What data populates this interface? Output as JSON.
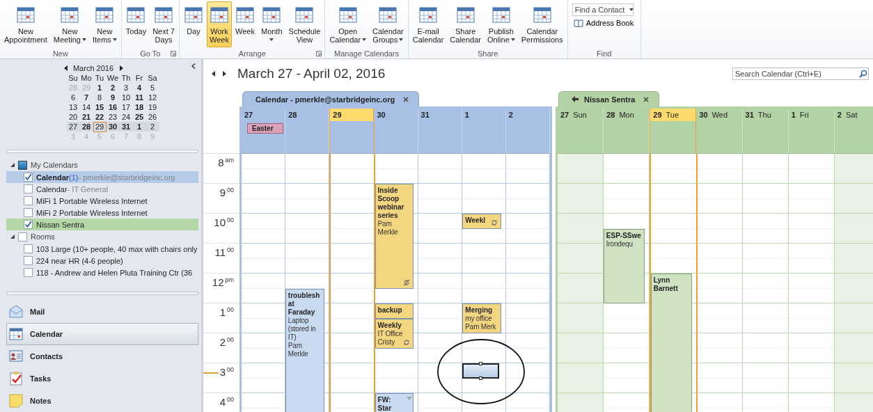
{
  "ribbon": {
    "groups": [
      {
        "kind": "buttons",
        "label": "New",
        "launcher": false,
        "buttons": [
          {
            "lines": [
              "New",
              "Appointment"
            ],
            "dropdown": false,
            "selected": false
          },
          {
            "lines": [
              "New",
              "Meeting"
            ],
            "dropdown": true,
            "selected": false
          },
          {
            "lines": [
              "New",
              "Items"
            ],
            "dropdown": true,
            "selected": false
          }
        ]
      },
      {
        "kind": "buttons",
        "label": "Go To",
        "launcher": true,
        "buttons": [
          {
            "lines": [
              "Today"
            ],
            "dropdown": false,
            "selected": false
          },
          {
            "lines": [
              "Next 7",
              "Days"
            ],
            "dropdown": false,
            "selected": false
          }
        ]
      },
      {
        "kind": "buttons",
        "label": "Arrange",
        "launcher": true,
        "buttons": [
          {
            "lines": [
              "Day"
            ],
            "dropdown": false,
            "selected": false
          },
          {
            "lines": [
              "Work",
              "Week"
            ],
            "dropdown": false,
            "selected": true
          },
          {
            "lines": [
              "Week"
            ],
            "dropdown": false,
            "selected": false
          },
          {
            "lines": [
              "Month"
            ],
            "dropdown": true,
            "selected": false
          },
          {
            "lines": [
              "Schedule",
              "View"
            ],
            "dropdown": false,
            "selected": false
          }
        ]
      },
      {
        "kind": "buttons",
        "label": "Manage Calendars",
        "launcher": false,
        "buttons": [
          {
            "lines": [
              "Open",
              "Calendar"
            ],
            "dropdown": true,
            "selected": false
          },
          {
            "lines": [
              "Calendar",
              "Groups"
            ],
            "dropdown": true,
            "selected": false
          }
        ]
      },
      {
        "kind": "buttons",
        "label": "Share",
        "launcher": false,
        "buttons": [
          {
            "lines": [
              "E-mail",
              "Calendar"
            ],
            "dropdown": false,
            "selected": false
          },
          {
            "lines": [
              "Share",
              "Calendar"
            ],
            "dropdown": false,
            "selected": false
          },
          {
            "lines": [
              "Publish",
              "Online"
            ],
            "dropdown": true,
            "selected": false
          },
          {
            "lines": [
              "Calendar",
              "Permissions"
            ],
            "dropdown": false,
            "selected": false
          }
        ]
      },
      {
        "kind": "find",
        "label": "Find",
        "launcher": false,
        "contact_field": {
          "placeholder": "Find a Contact"
        },
        "address_book": "Address Book"
      }
    ]
  },
  "sidebar": {
    "mini_calendar": {
      "month": "March 2016",
      "weekdays": [
        "Su",
        "Mo",
        "Tu",
        "We",
        "Th",
        "Fr",
        "Sa"
      ],
      "weeks": [
        {
          "selected": false,
          "days": [
            {
              "d": "28",
              "other": true,
              "bold": false,
              "today": false
            },
            {
              "d": "29",
              "other": true,
              "bold": false,
              "today": false
            },
            {
              "d": "1",
              "other": false,
              "bold": true,
              "today": false
            },
            {
              "d": "2",
              "other": false,
              "bold": true,
              "today": false
            },
            {
              "d": "3",
              "other": false,
              "bold": false,
              "today": false
            },
            {
              "d": "4",
              "other": false,
              "bold": true,
              "today": false
            },
            {
              "d": "5",
              "other": false,
              "bold": false,
              "today": false
            }
          ]
        },
        {
          "selected": false,
          "days": [
            {
              "d": "6",
              "other": false,
              "bold": false,
              "today": false
            },
            {
              "d": "7",
              "other": false,
              "bold": true,
              "today": false
            },
            {
              "d": "8",
              "other": false,
              "bold": false,
              "today": false
            },
            {
              "d": "9",
              "other": false,
              "bold": true,
              "today": false
            },
            {
              "d": "10",
              "other": false,
              "bold": false,
              "today": false
            },
            {
              "d": "11",
              "other": false,
              "bold": true,
              "today": false
            },
            {
              "d": "12",
              "other": false,
              "bold": false,
              "today": false
            }
          ]
        },
        {
          "selected": false,
          "days": [
            {
              "d": "13",
              "other": false,
              "bold": false,
              "today": false
            },
            {
              "d": "14",
              "other": false,
              "bold": false,
              "today": false
            },
            {
              "d": "15",
              "other": false,
              "bold": true,
              "today": false
            },
            {
              "d": "16",
              "other": false,
              "bold": true,
              "today": false
            },
            {
              "d": "17",
              "other": false,
              "bold": false,
              "today": false
            },
            {
              "d": "18",
              "other": false,
              "bold": true,
              "today": false
            },
            {
              "d": "19",
              "other": false,
              "bold": false,
              "today": false
            }
          ]
        },
        {
          "selected": false,
          "days": [
            {
              "d": "20",
              "other": false,
              "bold": false,
              "today": false
            },
            {
              "d": "21",
              "other": false,
              "bold": true,
              "today": false
            },
            {
              "d": "22",
              "other": false,
              "bold": true,
              "today": false
            },
            {
              "d": "23",
              "other": false,
              "bold": false,
              "today": false
            },
            {
              "d": "24",
              "other": false,
              "bold": false,
              "today": false
            },
            {
              "d": "25",
              "other": false,
              "bold": true,
              "today": false
            },
            {
              "d": "26",
              "other": false,
              "bold": false,
              "today": false
            }
          ]
        },
        {
          "selected": true,
          "days": [
            {
              "d": "27",
              "other": false,
              "bold": false,
              "today": false
            },
            {
              "d": "28",
              "other": false,
              "bold": true,
              "today": false
            },
            {
              "d": "29",
              "other": false,
              "bold": false,
              "today": true
            },
            {
              "d": "30",
              "other": false,
              "bold": true,
              "today": false
            },
            {
              "d": "31",
              "other": false,
              "bold": true,
              "today": false
            },
            {
              "d": "1",
              "other": false,
              "bold": true,
              "today": false
            },
            {
              "d": "2",
              "other": false,
              "bold": false,
              "today": false
            }
          ]
        },
        {
          "selected": false,
          "days": [
            {
              "d": "3",
              "other": true,
              "bold": false,
              "today": false
            },
            {
              "d": "4",
              "other": true,
              "bold": false,
              "today": false
            },
            {
              "d": "5",
              "other": true,
              "bold": false,
              "today": false
            },
            {
              "d": "6",
              "other": true,
              "bold": false,
              "today": false
            },
            {
              "d": "7",
              "other": true,
              "bold": false,
              "today": false
            },
            {
              "d": "8",
              "other": true,
              "bold": false,
              "today": false
            },
            {
              "d": "9",
              "other": true,
              "bold": false,
              "today": false
            }
          ]
        }
      ]
    },
    "folders": [
      {
        "label": "My Calendars",
        "expanded": true,
        "checked": true,
        "items": [
          {
            "name": "Calendar",
            "count": "(1)",
            "detail": "- pmerkle@starbridgeinc.org",
            "checked": true,
            "color": "#b6cbe8"
          },
          {
            "name": "Calendar",
            "detail": "- IT General",
            "checked": false
          },
          {
            "name": "MiFi 1 Portable Wireless Internet",
            "checked": false
          },
          {
            "name": "MiFi 2 Portable Wireless Internet",
            "checked": false
          },
          {
            "name": "Nissan Sentra",
            "checked": true,
            "color": "#b5d6a7"
          }
        ]
      },
      {
        "label": "Rooms",
        "expanded": true,
        "checked": false,
        "items": [
          {
            "name": "103 Large (10+ people, 40 max with chairs only",
            "checked": false
          },
          {
            "name": "224 near HR (4-6 people)",
            "checked": false
          },
          {
            "name": "118 - Andrew and Helen Pluta Training Ctr (36",
            "checked": false
          }
        ]
      }
    ],
    "nav": [
      {
        "label": "Mail",
        "selected": false
      },
      {
        "label": "Calendar",
        "selected": true
      },
      {
        "label": "Contacts",
        "selected": false
      },
      {
        "label": "Tasks",
        "selected": false
      },
      {
        "label": "Notes",
        "selected": false
      }
    ]
  },
  "main": {
    "title": "March 27 - April 02, 2016",
    "search": {
      "placeholder": "Search Calendar (Ctrl+E)"
    },
    "time_labels": [
      {
        "hour": "8",
        "suffix": "am"
      },
      {
        "hour": "9",
        "suffix": "00"
      },
      {
        "hour": "10",
        "suffix": "00"
      },
      {
        "hour": "11",
        "suffix": "00"
      },
      {
        "hour": "12",
        "suffix": "pm"
      },
      {
        "hour": "1",
        "suffix": "00"
      },
      {
        "hour": "2",
        "suffix": "00"
      },
      {
        "hour": "3",
        "suffix": "00"
      },
      {
        "hour": "4",
        "suffix": "00"
      }
    ],
    "panes": [
      {
        "title": "Calendar - pmerkle@starbridgeinc.org",
        "overlay_arrow": false,
        "color": "#a7c0e3",
        "days": [
          {
            "number": "27",
            "today": false,
            "shaded": false,
            "all_day": [
              {
                "title": "Easter",
                "color": "#dba3ba"
              }
            ]
          },
          {
            "number": "28",
            "today": false,
            "shaded": false,
            "events": [
              {
                "kind": "appointment",
                "title": "troublesh at Faraday",
                "detail": [
                  "Laptop (stored in IT)",
                  "Pam Merkle"
                ],
                "color": "#c9dbf0"
              }
            ]
          },
          {
            "number": "29",
            "today": true,
            "shaded": false
          },
          {
            "number": "30",
            "today": false,
            "shaded": false,
            "events": [
              {
                "kind": "exception",
                "title": "Inside Scoop webinar series",
                "detail": [
                  "Pam Merkle"
                ],
                "color": "#f5d680"
              },
              {
                "kind": "appointment",
                "title": "backup",
                "color": "#f5d680"
              },
              {
                "kind": "recurring",
                "title": "Weekly",
                "detail": [
                  "IT Office",
                  "Cristy"
                ],
                "color": "#f5d680"
              },
              {
                "kind": "overflow",
                "title": "FW: Star",
                "color": "#c9dbf0"
              }
            ]
          },
          {
            "number": "31",
            "today": false,
            "shaded": false
          },
          {
            "number": "1",
            "today": false,
            "shaded": false,
            "events": [
              {
                "kind": "recurring",
                "title": "Weekl",
                "color": "#f5d680"
              },
              {
                "kind": "appointment",
                "title": "Merging",
                "detail": [
                  "my office",
                  "Pam Merk"
                ],
                "color": "#f5d680"
              },
              {
                "kind": "selection",
                "circled": true
              }
            ]
          },
          {
            "number": "2",
            "today": false,
            "shaded": false
          }
        ]
      },
      {
        "title": "Nissan Sentra",
        "overlay_arrow": true,
        "color": "#b3d2a5",
        "days": [
          {
            "number": "27",
            "name": "Sun",
            "today": false,
            "shaded": true
          },
          {
            "number": "28",
            "name": "Mon",
            "today": false,
            "shaded": false,
            "events": [
              {
                "kind": "appointment",
                "title": "ESP-SSwe",
                "detail": [
                  "Irondequ"
                ],
                "color": "#cfe3c3"
              }
            ]
          },
          {
            "number": "29",
            "name": "Tue",
            "today": true,
            "shaded": false,
            "events": [
              {
                "kind": "appointment",
                "title": "Lynn Barnett",
                "color": "#cfe3c3"
              }
            ]
          },
          {
            "number": "30",
            "name": "Wed",
            "today": false,
            "shaded": false
          },
          {
            "number": "31",
            "name": "Thu",
            "today": false,
            "shaded": false
          },
          {
            "number": "1",
            "name": "Fri",
            "today": false,
            "shaded": false
          },
          {
            "number": "2",
            "name": "Sat",
            "today": false,
            "shaded": true
          }
        ]
      }
    ]
  }
}
